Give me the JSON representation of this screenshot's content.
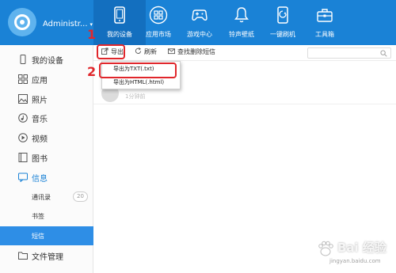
{
  "header": {
    "account_name": "Administr...",
    "caret": "▾",
    "nav": [
      {
        "label": "我的设备",
        "icon": "phone-icon"
      },
      {
        "label": "应用市场",
        "icon": "apps-grid-icon"
      },
      {
        "label": "游戏中心",
        "icon": "gamepad-icon"
      },
      {
        "label": "铃声壁纸",
        "icon": "bell-icon"
      },
      {
        "label": "一键刷机",
        "icon": "flash-phone-icon"
      },
      {
        "label": "工具箱",
        "icon": "toolbox-icon"
      }
    ]
  },
  "sidebar": {
    "items": [
      {
        "label": "我的设备",
        "icon": "device-icon"
      },
      {
        "label": "应用",
        "icon": "apps-icon"
      },
      {
        "label": "照片",
        "icon": "photo-icon"
      },
      {
        "label": "音乐",
        "icon": "music-icon"
      },
      {
        "label": "视频",
        "icon": "video-icon"
      },
      {
        "label": "图书",
        "icon": "book-icon"
      },
      {
        "label": "信息",
        "icon": "message-icon"
      },
      {
        "label": "通讯录",
        "badge": "20"
      },
      {
        "label": "书签"
      },
      {
        "label": "短信"
      },
      {
        "label": "文件管理",
        "icon": "folder-icon"
      }
    ]
  },
  "toolbar": {
    "export_label": "导出",
    "refresh_label": "刷新",
    "find_deleted_label": "查找删除短信",
    "search_placeholder": ""
  },
  "list": {
    "row_sub": "1分钟前"
  },
  "dropdown": {
    "items": [
      "导出为TXT(.txt)",
      "导出为HTML(.html)"
    ]
  },
  "annotations": {
    "step1": "1",
    "step2": "2"
  },
  "watermark": {
    "text": "Bai 经验",
    "sub": "jingyan.baidu.com"
  },
  "colors": {
    "header_blue": "#1a82d6",
    "active_blue": "#2e8ee6",
    "annotation_red": "#e0262b"
  }
}
